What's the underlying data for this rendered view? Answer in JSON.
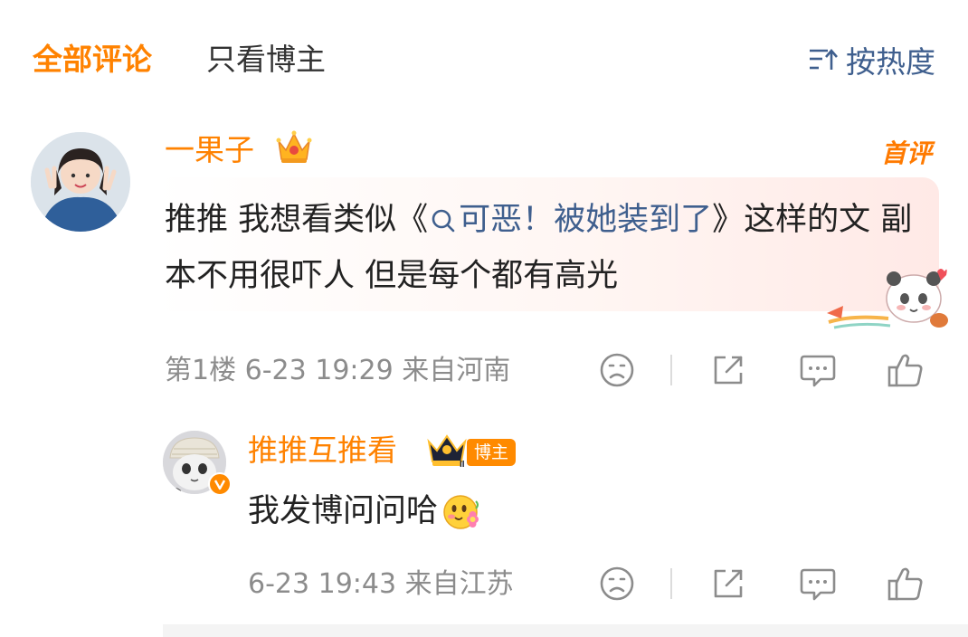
{
  "tabs": {
    "all": "全部评论",
    "blogger_only": "只看博主",
    "sort": "按热度"
  },
  "comment": {
    "username": "一果子",
    "first_badge": "首评",
    "text_before": "推推 我想看类似《",
    "link_text": "可恶！被她装到了",
    "text_after": "》这样的文 副本不用很吓人 但是每个都有高光",
    "meta": "第1楼 6-23 19:29 来自河南"
  },
  "reply": {
    "username": "推推互推看",
    "role_tag": "博主",
    "text": "我发博问问哈",
    "meta": "6-23 19:43 来自江苏"
  },
  "colors": {
    "accent": "#ff8200",
    "link": "#3f5f8e",
    "meta": "#8c8c8c"
  },
  "icons": [
    "sort-icon",
    "search-icon",
    "dislike-icon",
    "share-icon",
    "comment-icon",
    "like-icon",
    "crown-icon",
    "verified-icon",
    "flower-emoji"
  ]
}
